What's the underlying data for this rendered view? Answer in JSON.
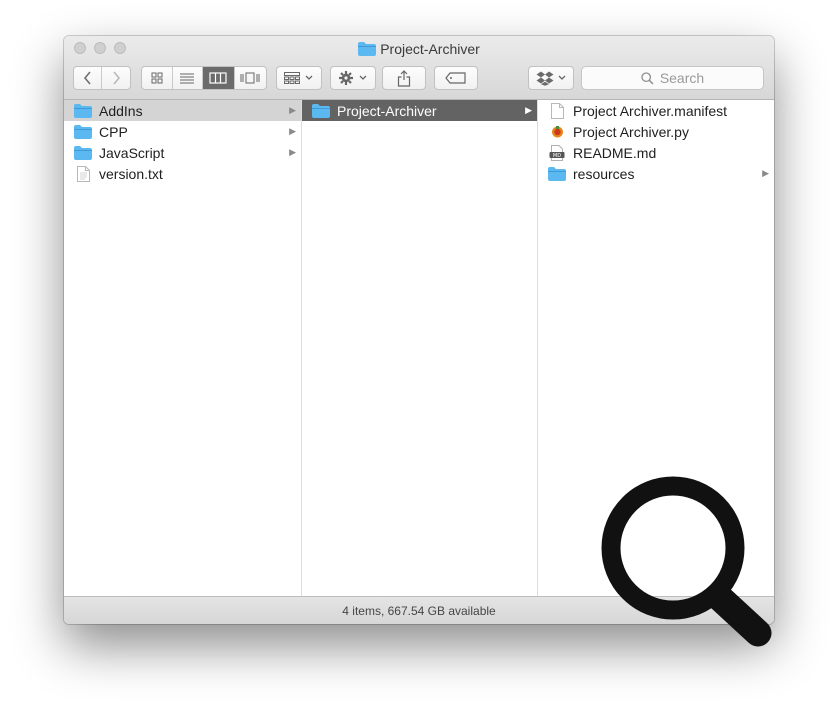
{
  "window": {
    "title": "Project-Archiver"
  },
  "toolbar": {
    "back_icon": "chevron-left-icon",
    "forward_icon": "chevron-right-icon",
    "view_modes": [
      "icon-view",
      "list-view",
      "column-view",
      "cover-flow-view"
    ],
    "active_view": "column-view",
    "group_icon": "arrange-grid-icon",
    "action_icon": "gear-icon",
    "share_icon": "share-icon",
    "tag_icon": "tag-icon",
    "dropbox_icon": "dropbox-icon",
    "search_placeholder": "Search"
  },
  "columns": [
    {
      "items": [
        {
          "label": "AddIns",
          "icon": "folder-icon",
          "has_children": true,
          "selected": "inactive"
        },
        {
          "label": "CPP",
          "icon": "folder-icon",
          "has_children": true
        },
        {
          "label": "JavaScript",
          "icon": "folder-icon",
          "has_children": true
        },
        {
          "label": "version.txt",
          "icon": "text-file-icon",
          "has_children": false
        }
      ]
    },
    {
      "items": [
        {
          "label": "Project-Archiver",
          "icon": "folder-icon",
          "has_children": true,
          "selected": "active"
        }
      ]
    },
    {
      "items": [
        {
          "label": "Project Archiver.manifest",
          "icon": "blank-file-icon",
          "has_children": false
        },
        {
          "label": "Project Archiver.py",
          "icon": "python-file-icon",
          "has_children": false
        },
        {
          "label": "README.md",
          "icon": "markdown-file-icon",
          "has_children": false
        },
        {
          "label": "resources",
          "icon": "folder-icon",
          "has_children": true
        }
      ]
    }
  ],
  "status_bar": {
    "text": "4 items, 667.54 GB available"
  },
  "colors": {
    "folder": "#5cb8f0",
    "selection_active": "#636363",
    "selection_inactive": "#d4d4d4"
  }
}
